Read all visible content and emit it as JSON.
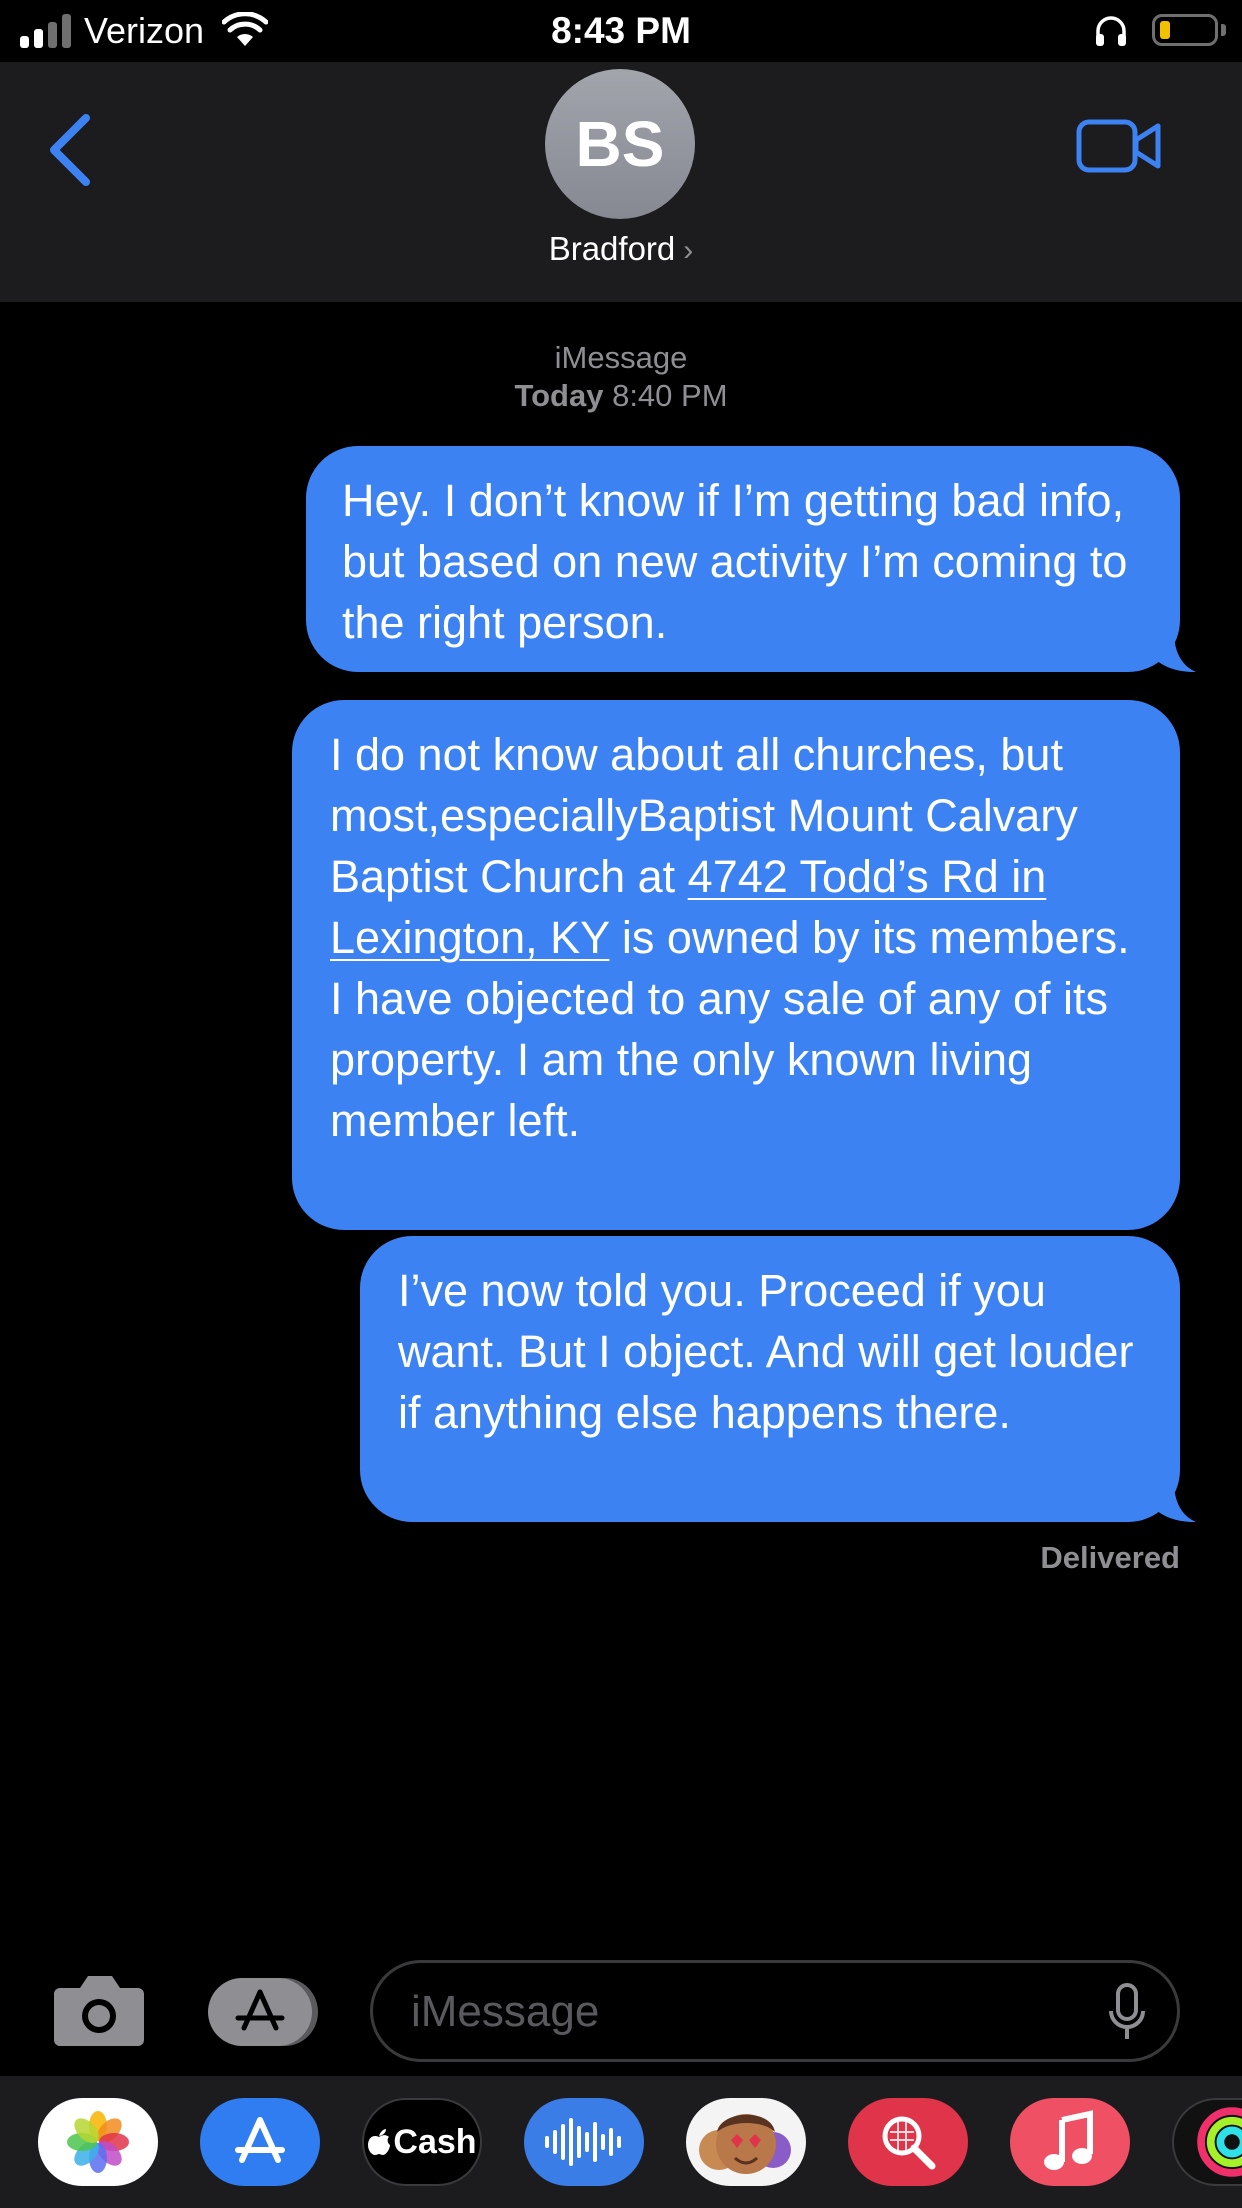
{
  "status_bar": {
    "carrier": "Verizon",
    "time": "8:43 PM",
    "battery_color": "#f2c200"
  },
  "header": {
    "avatar_initials": "BS",
    "contact_name": "Bradford",
    "contact_chevron": "›",
    "back_icon": "chevron-left-icon",
    "video_icon": "video-camera-icon"
  },
  "conversation": {
    "service": "iMessage",
    "date_bold": "Today",
    "time": "8:40 PM",
    "messages": [
      {
        "text": "Hey. I don’t know if I’m getting bad info, but based on new activity I’m coming to the right person."
      },
      {
        "text_before": "I do not know about all churches, but most,especiallyBaptist Mount Calvary Baptist Church at ",
        "link": "4742 Todd’s Rd in Lexington, KY",
        "text_after": " is owned by its members. I have objected to any sale of any of its property. I am the only known living member left."
      },
      {
        "text": "I’ve now told you. Proceed if you want. But I object. And will get louder if anything else happens there."
      }
    ],
    "delivery_status": "Delivered",
    "bubble_color": "#3d82f3"
  },
  "input_bar": {
    "placeholder": "iMessage"
  },
  "app_drawer": {
    "cash_label": "Cash",
    "apps": [
      "photos-icon",
      "app-store-icon",
      "apple-cash-icon",
      "audio-message-icon",
      "memoji-icon",
      "images-search-icon",
      "music-icon",
      "fitness-icon"
    ]
  }
}
